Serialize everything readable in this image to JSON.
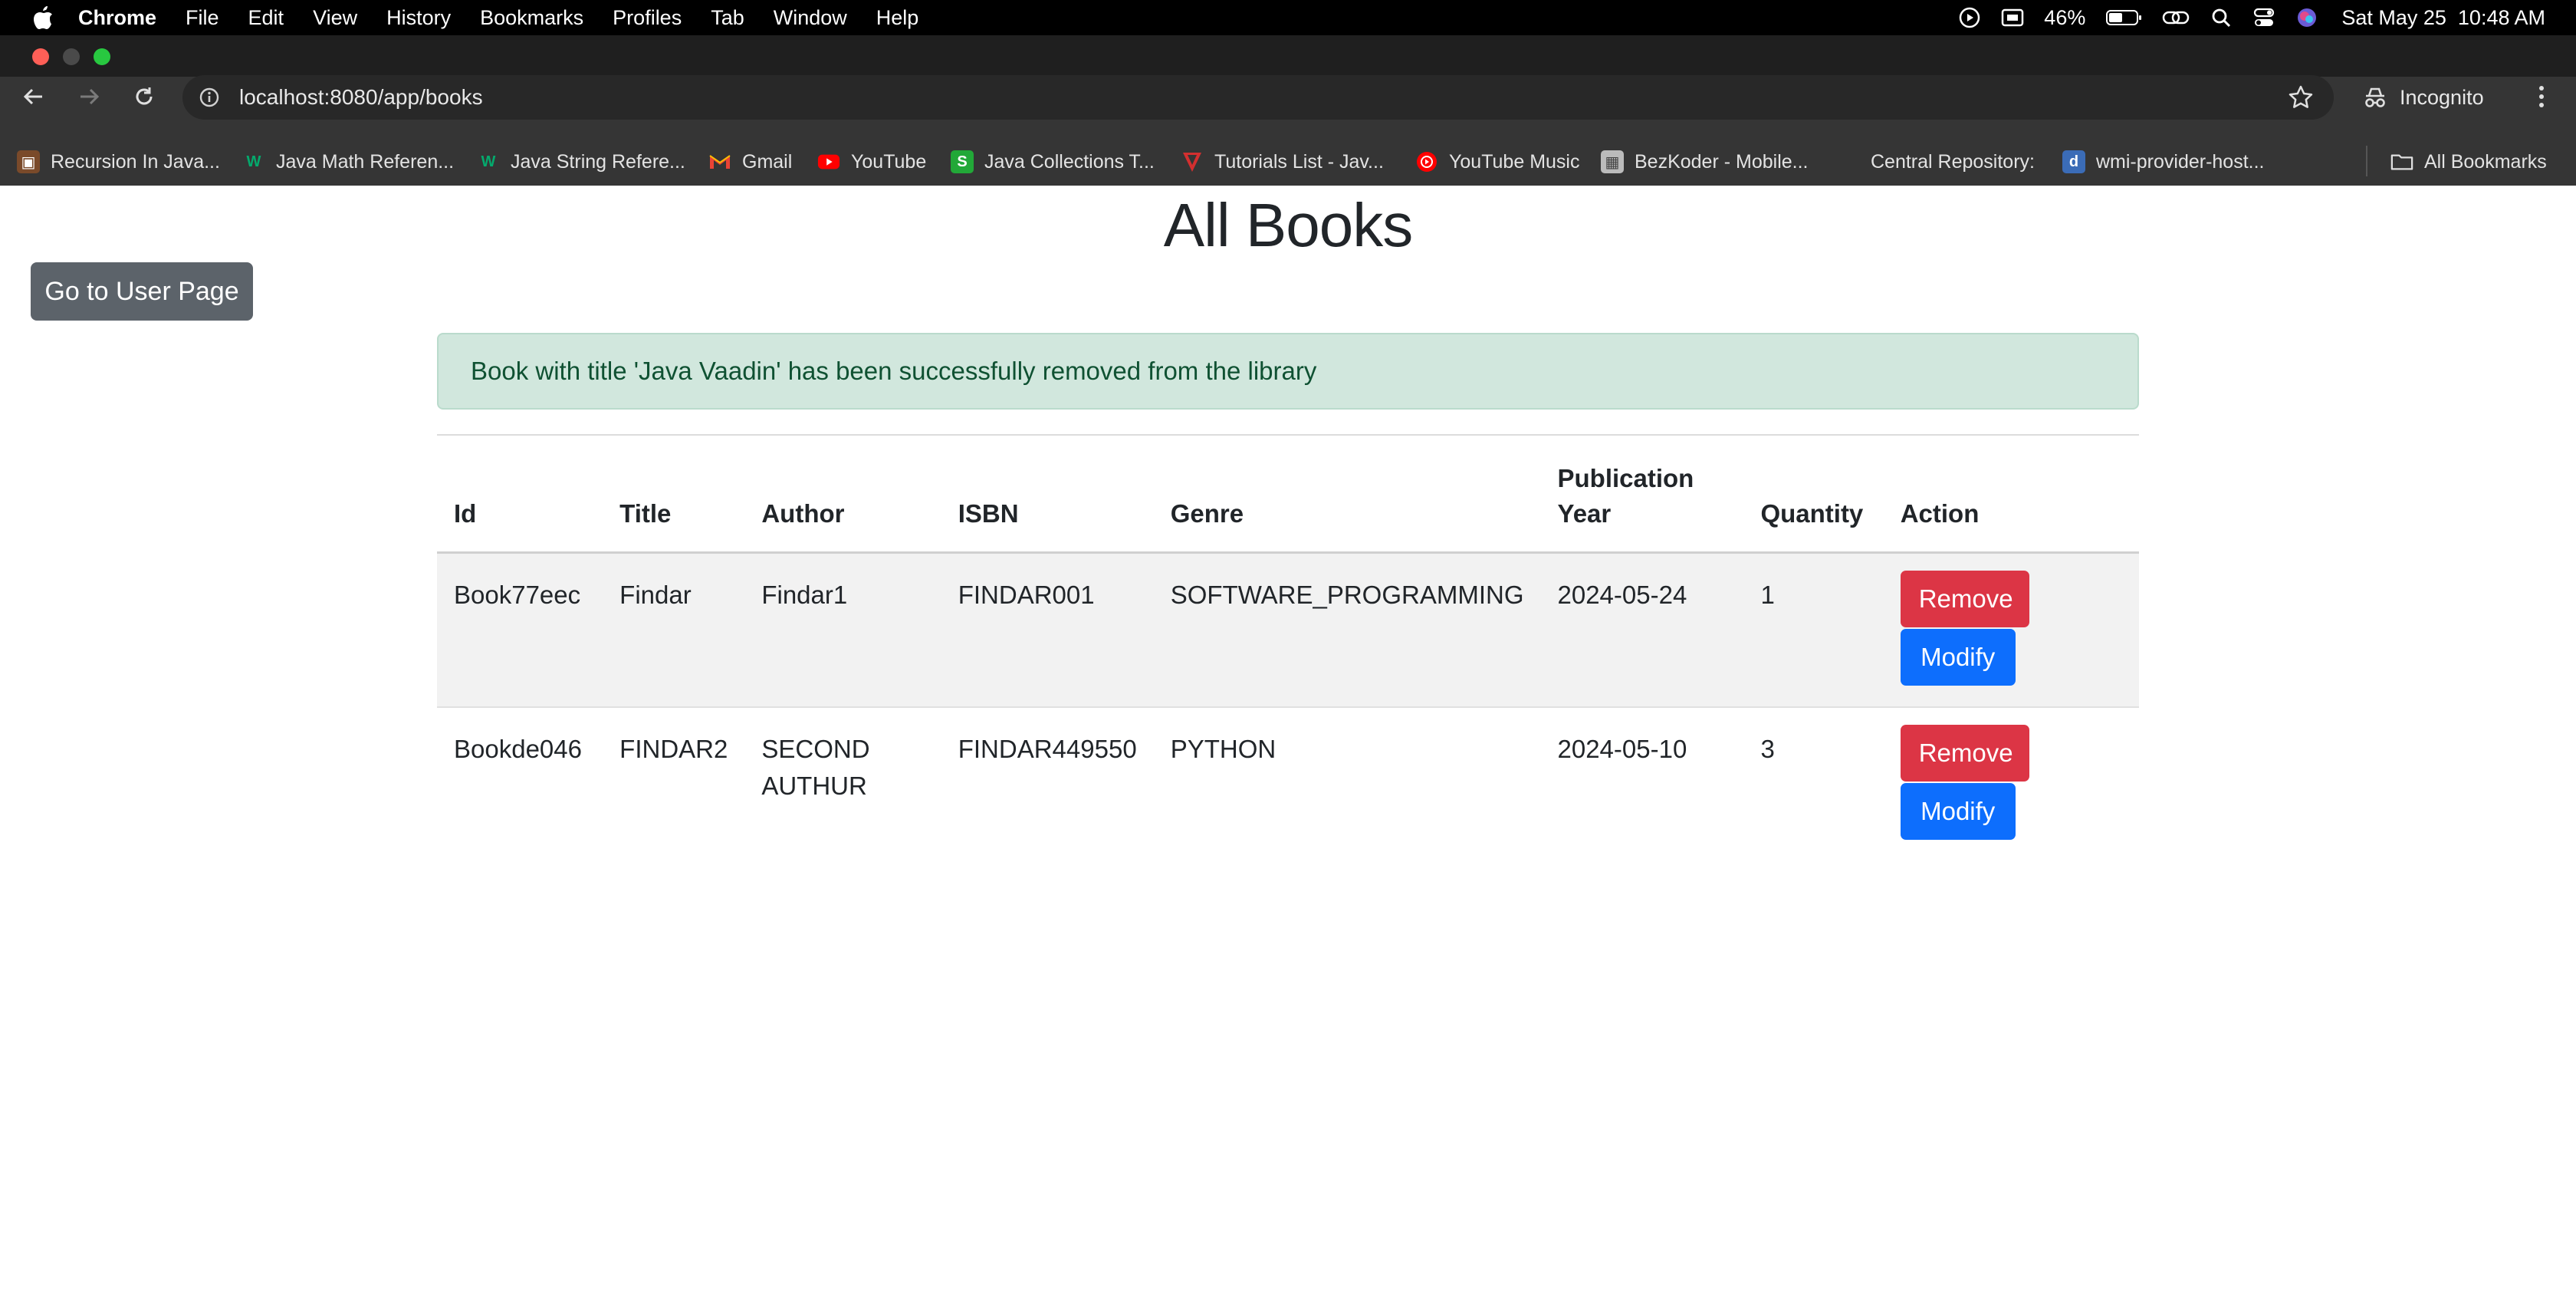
{
  "menubar": {
    "app": "Chrome",
    "items": [
      "File",
      "Edit",
      "View",
      "History",
      "Bookmarks",
      "Profiles",
      "Tab",
      "Window",
      "Help"
    ],
    "battery": "46%",
    "datetime": "Sat May 25  10:48 AM"
  },
  "browser": {
    "url": "localhost:8080/app/books",
    "incognito_label": "Incognito",
    "bookmarks": [
      {
        "label": "Recursion In Java...",
        "icon": "book-favicon",
        "color": "#7a4a2a"
      },
      {
        "label": "Java Math Referen...",
        "icon": "w3-favicon",
        "color": "#04aa6d"
      },
      {
        "label": "Java String Refere...",
        "icon": "w3-favicon",
        "color": "#04aa6d"
      },
      {
        "label": "Gmail",
        "icon": "gmail-favicon",
        "color": "#ea4335"
      },
      {
        "label": "YouTube",
        "icon": "youtube-favicon",
        "color": "#ff0000"
      },
      {
        "label": "Java Collections T...",
        "icon": "s-favicon",
        "color": "#22a838"
      },
      {
        "label": "Tutorials List - Jav...",
        "icon": "v-favicon",
        "color": "#d32f2f"
      },
      {
        "label": "YouTube Music",
        "icon": "youtube-music-favicon",
        "color": "#ff0000"
      },
      {
        "label": "BezKoder - Mobile...",
        "icon": "bezkoder-favicon",
        "color": "#bbbbbb"
      },
      {
        "label": "Central Repository:",
        "icon": "",
        "color": ""
      },
      {
        "label": "wmi-provider-host...",
        "icon": "d-favicon",
        "color": "#3b6cb7"
      }
    ],
    "all_bookmarks": "All Bookmarks"
  },
  "page": {
    "title": "All Books",
    "user_page_button": "Go to User Page",
    "alert": "Book with title 'Java Vaadin' has been successfully removed from the library",
    "table": {
      "headers": [
        "Id",
        "Title",
        "Author",
        "ISBN",
        "Genre",
        "Publication Year",
        "Quantity",
        "Action"
      ],
      "rows": [
        {
          "id": "Book77eec",
          "title": "Findar",
          "author": "Findar1",
          "isbn": "FINDAR001",
          "genre": "SOFTWARE_PROGRAMMING",
          "year": "2024-05-24",
          "quantity": "1"
        },
        {
          "id": "Bookde046",
          "title": "FINDAR2",
          "author": "SECOND AUTHUR",
          "isbn": "FINDAR449550",
          "genre": "PYTHON",
          "year": "2024-05-10",
          "quantity": "3"
        }
      ],
      "remove_label": "Remove",
      "modify_label": "Modify"
    }
  }
}
